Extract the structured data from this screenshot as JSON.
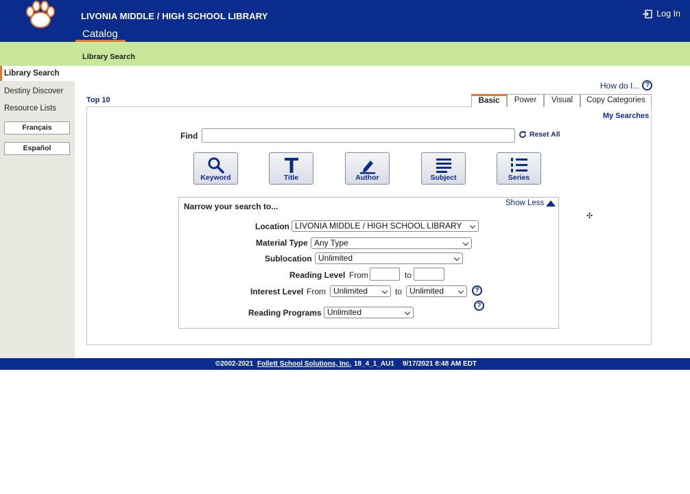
{
  "header": {
    "school_name": "LIVONIA MIDDLE / HIGH SCHOOL LIBRARY",
    "catalog_tab": "Catalog",
    "login_label": "Log In",
    "logo_icon": "paw-icon",
    "background": "#0a2c8c",
    "accent": "#e8742a"
  },
  "subbar": {
    "label": "Library Search",
    "background": "#c9e79a"
  },
  "sidebar": {
    "items": [
      {
        "label": "Library Search",
        "active": true
      },
      {
        "label": "Destiny Discover",
        "active": false
      },
      {
        "label": "Resource Lists",
        "active": false
      }
    ],
    "language_buttons": [
      "Français",
      "Español"
    ]
  },
  "main": {
    "how_do_i": "How do I...",
    "top10": "Top 10",
    "tabs": [
      "Basic",
      "Power",
      "Visual",
      "Copy Categories"
    ],
    "active_tab": "Basic",
    "my_searches": "My Searches",
    "find_label": "Find",
    "find_value": "",
    "reset_all": "Reset All",
    "search_buttons": [
      {
        "label": "Keyword",
        "icon": "magnifier-icon"
      },
      {
        "label": "Title",
        "icon": "title-t-icon"
      },
      {
        "label": "Author",
        "icon": "pencil-icon"
      },
      {
        "label": "Subject",
        "icon": "lines-icon"
      },
      {
        "label": "Series",
        "icon": "numbered-list-icon"
      }
    ]
  },
  "narrow": {
    "title": "Narrow your search to...",
    "show_less": "Show Less",
    "location_label": "Location",
    "location_value": "LIVONIA MIDDLE / HIGH SCHOOL LIBRARY",
    "material_label": "Material Type",
    "material_value": "Any Type",
    "sublocation_label": "Sublocation",
    "sublocation_value": "Unlimited",
    "reading_level_label": "Reading Level",
    "from_text": "From",
    "to_text": "to",
    "reading_from_value": "",
    "reading_to_value": "",
    "interest_label": "Interest Level",
    "interest_from_value": "Unlimited",
    "interest_to_value": "Unlimited",
    "programs_label": "Reading Programs",
    "programs_value": "Unlimited"
  },
  "footer": {
    "copyright": "©2002-2021",
    "company_link": "Follett School Solutions, Inc.",
    "version": "18_4_1_AU1",
    "timestamp": "9/17/2021 8:48 AM EDT"
  }
}
